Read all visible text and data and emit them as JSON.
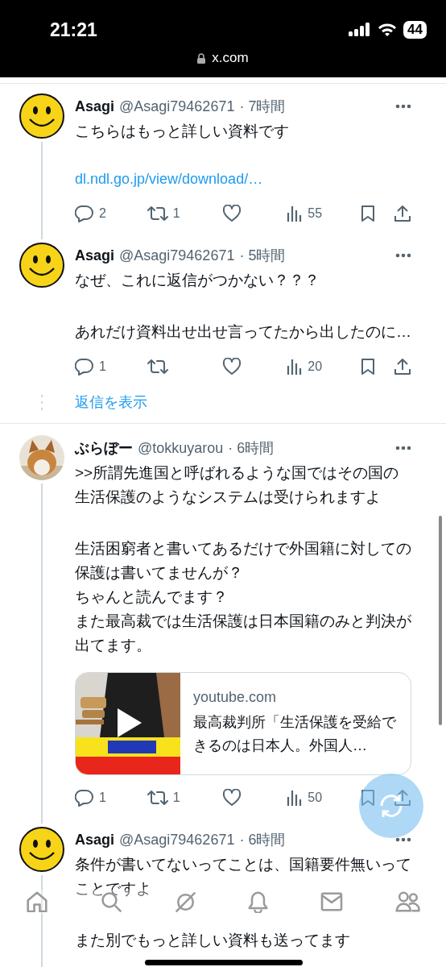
{
  "status_bar": {
    "time": "21:21",
    "battery": "44",
    "url": "x.com"
  },
  "threads": [
    {
      "tweets": [
        {
          "avatar": {
            "kind": "smiley"
          },
          "name": "Asagi",
          "handle": "@Asagi79462671",
          "time": "· 7時間",
          "thread_line": true,
          "paragraphs": [
            [
              "こちらはもっと詳しい資料です"
            ]
          ],
          "link": "dl.ndl.go.jp/view/download/…",
          "actions": [
            {
              "kind": "reply",
              "count": "2"
            },
            {
              "kind": "retweet",
              "count": "1"
            },
            {
              "kind": "like"
            },
            {
              "kind": "views",
              "count": "55"
            },
            {
              "kind": "bookmark"
            },
            {
              "kind": "share"
            }
          ]
        },
        {
          "avatar": {
            "kind": "smiley"
          },
          "name": "Asagi",
          "handle": "@Asagi79462671",
          "time": "· 5時間",
          "thread_line": false,
          "paragraphs": [
            [
              "なぜ、これに返信がつかない？？？"
            ],
            [
              "あれだけ資料出せ出せ言ってたから出したのに…"
            ]
          ],
          "actions": [
            {
              "kind": "reply",
              "count": "1"
            },
            {
              "kind": "retweet"
            },
            {
              "kind": "like"
            },
            {
              "kind": "views",
              "count": "20"
            },
            {
              "kind": "bookmark"
            },
            {
              "kind": "share"
            }
          ]
        }
      ],
      "show_replies": "返信を表示"
    },
    {
      "tweets": [
        {
          "avatar": {
            "kind": "picture"
          },
          "name": "ぶらぼー",
          "handle": "@tokkuyarou",
          "time": "· 6時間",
          "thread_line": true,
          "paragraphs": [
            [
              ">>所謂先進国と呼ばれるような国ではその国の生活保護のようなシステムは受けられますよ"
            ],
            [
              "生活困窮者と書いてあるだけで外国籍に対しての保護は書いてませんが？",
              "ちゃんと読んでます？",
              "また最高裁では生活保護は日本国籍のみと判決が出てます。"
            ]
          ],
          "card": {
            "kind": "picture",
            "domain": "youtube.com",
            "title": "最高裁判所「生活保護を受給できるのは日本人。外国人…"
          },
          "actions": [
            {
              "kind": "reply",
              "count": "1"
            },
            {
              "kind": "retweet",
              "count": "1"
            },
            {
              "kind": "like"
            },
            {
              "kind": "views",
              "count": "50"
            },
            {
              "kind": "bookmark"
            },
            {
              "kind": "share"
            }
          ]
        },
        {
          "avatar": {
            "kind": "smiley"
          },
          "name": "Asagi",
          "handle": "@Asagi79462671",
          "time": "· 6時間",
          "thread_line": true,
          "paragraphs": [
            [
              "条件が書いてないってことは、国籍要件無いってことですよ"
            ],
            [
              "また別でもっと詳しい資料も送ってます"
            ]
          ]
        }
      ]
    }
  ]
}
